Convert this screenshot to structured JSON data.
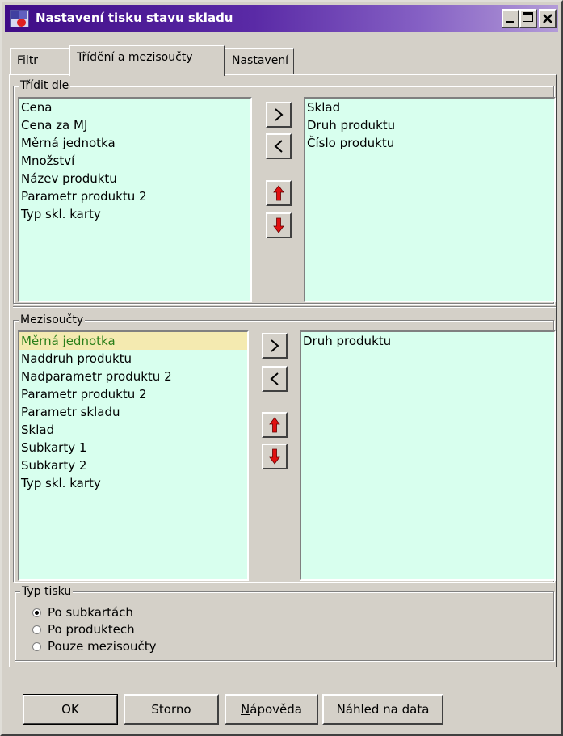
{
  "window": {
    "title": "Nastavení tisku stavu skladu"
  },
  "tabs": [
    {
      "label": "Filtr"
    },
    {
      "label": "Třídění a mezisoučty"
    },
    {
      "label": "Nastavení"
    }
  ],
  "sort_group": {
    "label": "Třídit dle",
    "available": [
      "Cena",
      "Cena za MJ",
      "Měrná jednotka",
      "Množství",
      "Název produktu",
      "Parametr produktu 2",
      "Typ skl. karty"
    ],
    "selected": [
      "Sklad",
      "Druh produktu",
      "Číslo produktu"
    ]
  },
  "subtotal_group": {
    "label": "Mezisoučty",
    "available": [
      "Měrná jednotka",
      "Naddruh produktu",
      "Nadparametr produktu 2",
      "Parametr produktu 2",
      "Parametr skladu",
      "Sklad",
      "Subkarty 1",
      "Subkarty 2",
      "Typ skl. karty"
    ],
    "highlighted": "Měrná jednotka",
    "selected": [
      "Druh produktu"
    ]
  },
  "print_type_group": {
    "label": "Typ tisku",
    "options": [
      "Po subkartách",
      "Po produktech",
      "Pouze mezisoučty"
    ],
    "checked": "Po subkartách"
  },
  "buttons": {
    "ok": "OK",
    "cancel": "Storno",
    "help": "Nápověda",
    "preview": "Náhled na data"
  },
  "icons": {
    "move_right": "chevron-right-icon",
    "move_left": "chevron-left-icon",
    "move_up": "red-arrow-up-icon",
    "move_down": "red-arrow-down-icon"
  },
  "colors": {
    "list_background": "#d8ffee",
    "highlight_background": "#f4eab0",
    "highlight_text": "#2a7f1a",
    "title_gradient_start": "#3f0c86",
    "arrow_red": "#e01010"
  }
}
